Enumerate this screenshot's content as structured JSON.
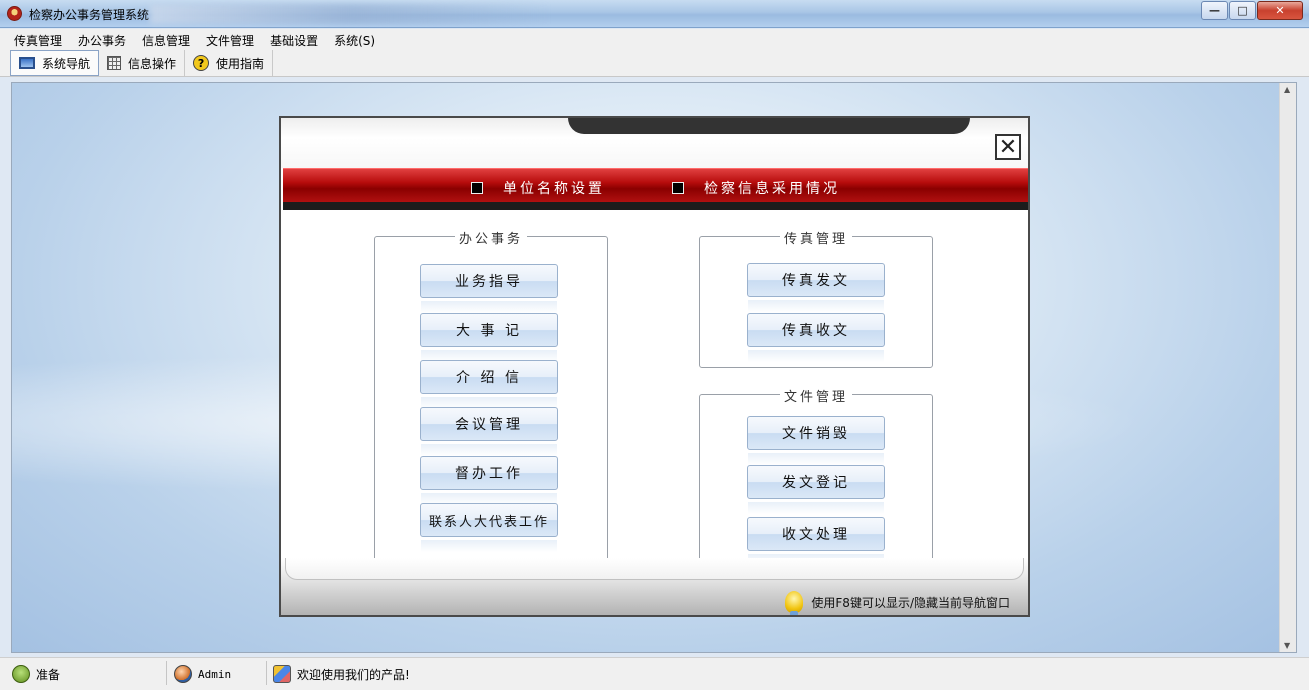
{
  "window": {
    "title": "检察办公事务管理系统",
    "buttons": {
      "minimize": "—",
      "maximize": "□",
      "close": "✕"
    }
  },
  "menubar": [
    "传真管理",
    "办公事务",
    "信息管理",
    "文件管理",
    "基础设置",
    "系统(S)"
  ],
  "toolbar": {
    "items": [
      {
        "label": "系统导航",
        "icon": "monitor-icon",
        "active": true
      },
      {
        "label": "信息操作",
        "icon": "grid-icon",
        "active": false
      },
      {
        "label": "使用指南",
        "icon": "help-icon",
        "active": false
      }
    ]
  },
  "nav": {
    "close": "✕",
    "links": [
      "单位名称设置",
      "检察信息采用情况"
    ],
    "groups": {
      "office": {
        "title": "办公事务",
        "buttons": [
          "业务指导",
          "大 事 记",
          "介 绍 信",
          "会议管理",
          "督办工作",
          "联系人大代表工作"
        ]
      },
      "fax": {
        "title": "传真管理",
        "buttons": [
          "传真发文",
          "传真收文"
        ]
      },
      "files": {
        "title": "文件管理",
        "buttons": [
          "文件销毁",
          "发文登记",
          "收文处理"
        ]
      }
    },
    "hint": "使用F8键可以显示/隐藏当前导航窗口"
  },
  "statusbar": {
    "ready": "准备",
    "user": "Admin",
    "welcome": "欢迎使用我们的产品!"
  },
  "colors": {
    "accent_red": "#b80d0d",
    "button_blue": "#c9dcf2"
  }
}
